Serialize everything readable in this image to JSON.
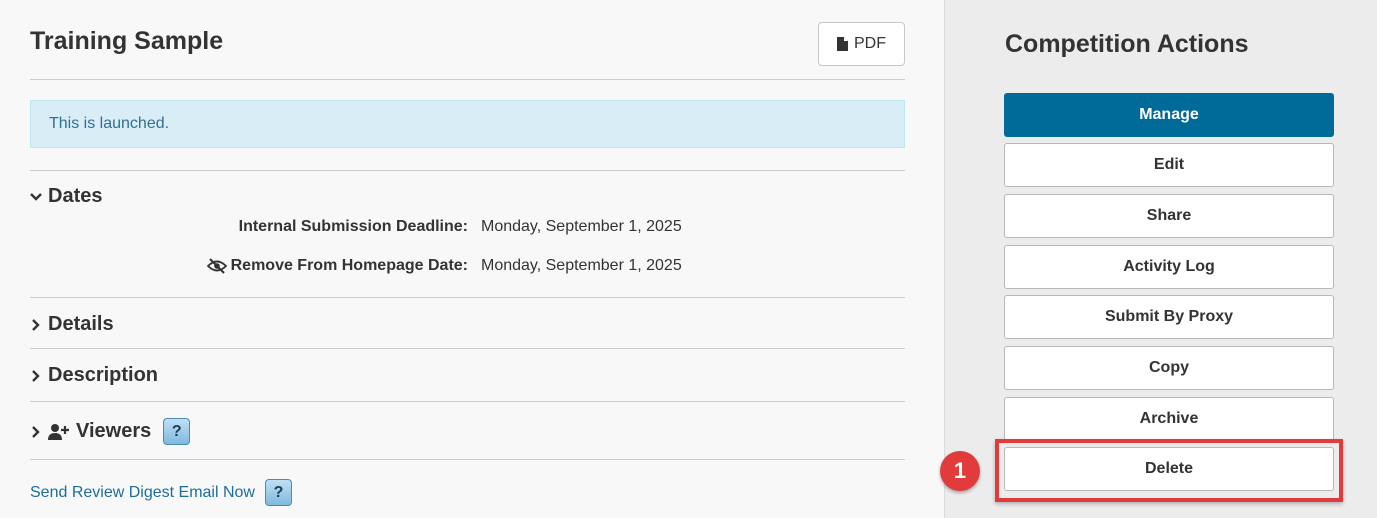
{
  "page": {
    "title": "Training Sample",
    "pdf_label": "PDF",
    "alert_text": "This is launched."
  },
  "sections": {
    "dates": {
      "label": "Dates",
      "rows": [
        {
          "label": "Internal Submission Deadline:",
          "value": "Monday, September 1, 2025",
          "icon": ""
        },
        {
          "label": "Remove From Homepage Date:",
          "value": "Monday, September 1, 2025",
          "icon": "eye-slash-icon"
        }
      ]
    },
    "details": {
      "label": "Details"
    },
    "description": {
      "label": "Description"
    },
    "viewers": {
      "label": "Viewers",
      "icon": "user-plus-icon"
    }
  },
  "help_label": "?",
  "digest_link": "Send Review Digest Email Now",
  "sidebar": {
    "title": "Competition Actions",
    "actions": [
      {
        "label": "Manage",
        "primary": true
      },
      {
        "label": "Edit"
      },
      {
        "label": "Share"
      },
      {
        "label": "Activity Log"
      },
      {
        "label": "Submit By Proxy"
      },
      {
        "label": "Copy"
      },
      {
        "label": "Archive"
      },
      {
        "label": "Delete"
      }
    ],
    "step_badge": "1"
  },
  "colors": {
    "primary": "#006b99",
    "alert_bg": "#d9edf7",
    "highlight": "#e23b3b",
    "link": "#1b6e99"
  }
}
